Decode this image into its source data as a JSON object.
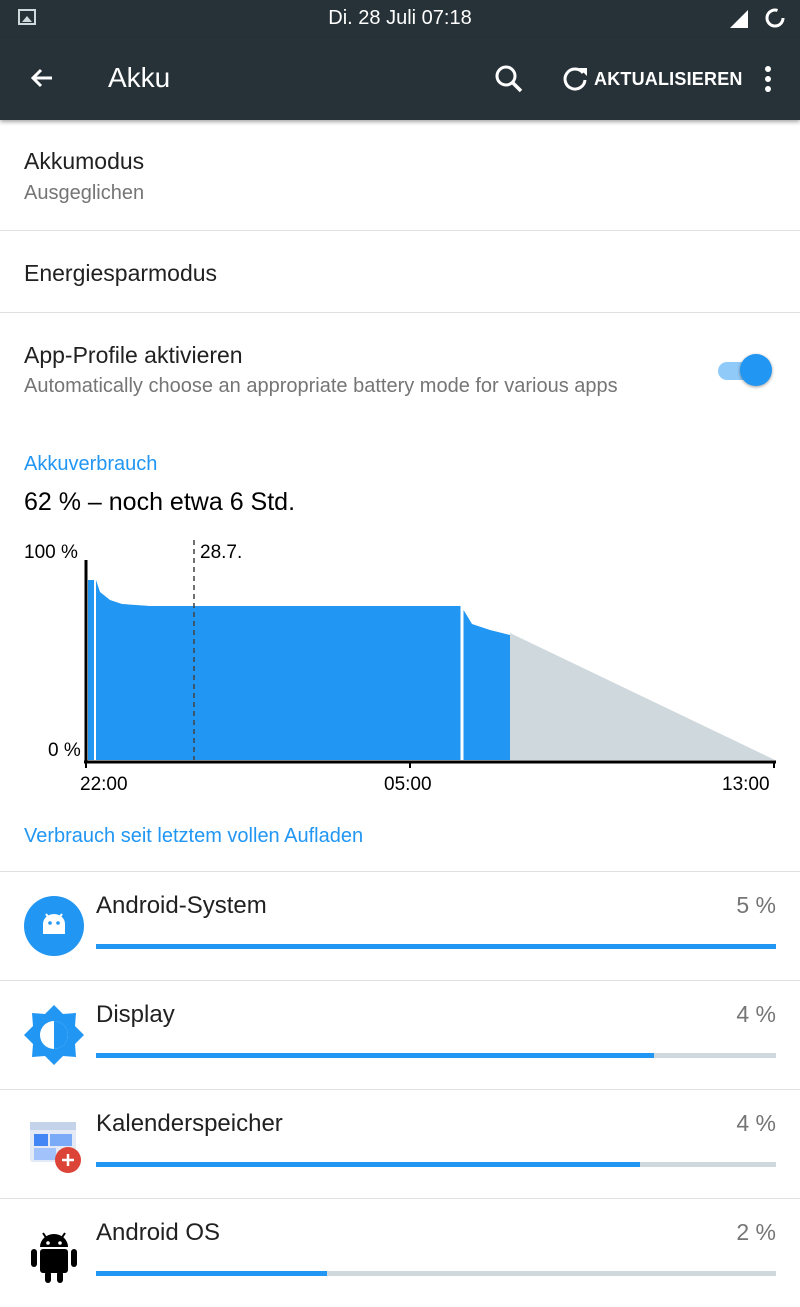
{
  "status_bar": {
    "time": "Di. 28 Juli 07:18"
  },
  "app_bar": {
    "title": "Akku",
    "refresh_label": "AKTUALISIEREN"
  },
  "settings": {
    "battery_mode": {
      "title": "Akkumodus",
      "value": "Ausgeglichen"
    },
    "power_saving": {
      "title": "Energiesparmodus"
    },
    "app_profiles": {
      "title": "App-Profile aktivieren",
      "summary": "Automatically choose an appropriate battery mode for various apps",
      "enabled": true
    }
  },
  "usage": {
    "header": "Akkuverbrauch",
    "summary": "62 % – noch etwa 6 Std."
  },
  "chart_data": {
    "type": "area",
    "ylabel_top": "100 %",
    "ylabel_bottom": "0 %",
    "ylim": [
      0,
      100
    ],
    "x_ticks": [
      "22:00",
      "05:00",
      "13:00"
    ],
    "marker_label": "28.7.",
    "series": [
      {
        "values_approx": [
          [
            0.0,
            86
          ],
          [
            0.5,
            86
          ],
          [
            1.0,
            77
          ],
          [
            3.0,
            76
          ],
          [
            10.5,
            75
          ],
          [
            11.8,
            64
          ],
          [
            12.6,
            62
          ]
        ]
      },
      {
        "values_approx": [
          [
            12.6,
            62
          ],
          [
            20.0,
            0
          ]
        ]
      }
    ],
    "colors": {
      "actual": "#2196f3",
      "projected": "#cfd8dc"
    }
  },
  "apps_header": "Verbrauch seit letztem vollen Aufladen",
  "apps": [
    {
      "name": "Android-System",
      "percent_label": "5 %",
      "fill": 1.0,
      "icon": "android-system-icon"
    },
    {
      "name": "Display",
      "percent_label": "4 %",
      "fill": 0.82,
      "icon": "display-brightness-icon"
    },
    {
      "name": "Kalenderspeicher",
      "percent_label": "4 %",
      "fill": 0.8,
      "icon": "calendar-storage-icon"
    },
    {
      "name": "Android OS",
      "percent_label": "2 %",
      "fill": 0.34,
      "icon": "android-os-icon"
    }
  ]
}
